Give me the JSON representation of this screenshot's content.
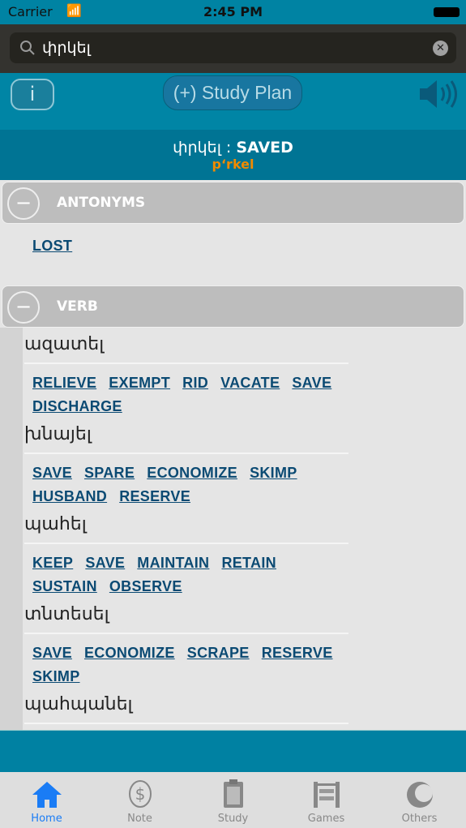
{
  "status": {
    "carrier": "Carrier",
    "time": "2:45 PM"
  },
  "search": {
    "value": "փրկել"
  },
  "toolbar": {
    "info_label": "i",
    "study_plan_label": "(+) Study Plan"
  },
  "title": {
    "word": "փրկել",
    "separator": " : ",
    "translation": "SAVED",
    "transliteration": "p‘rkel"
  },
  "sections": [
    {
      "label": "ANTONYMS",
      "links": [
        "LOST"
      ]
    },
    {
      "label": "VERB",
      "entries": [
        {
          "word": "ազատել",
          "links": [
            "RELIEVE",
            "EXEMPT",
            "RID",
            "VACATE",
            "SAVE",
            "DISCHARGE"
          ]
        },
        {
          "word": "խնայել",
          "links": [
            "SAVE",
            "SPARE",
            "ECONOMIZE",
            "SKIMP",
            "HUSBAND",
            "RESERVE"
          ]
        },
        {
          "word": "պահել",
          "links": [
            "KEEP",
            "SAVE",
            "MAINTAIN",
            "RETAIN",
            "SUSTAIN",
            "OBSERVE"
          ]
        },
        {
          "word": "տնտեսել",
          "links": [
            "SAVE",
            "ECONOMIZE",
            "SCRAPE",
            "RESERVE",
            "SKIMP"
          ]
        },
        {
          "word": "պահպանել",
          "links": []
        }
      ]
    }
  ],
  "tabs": [
    {
      "label": "Home",
      "icon": "home-icon",
      "active": true
    },
    {
      "label": "Note",
      "icon": "dollar-icon"
    },
    {
      "label": "Study",
      "icon": "clipboard-icon"
    },
    {
      "label": "Games",
      "icon": "abacus-icon"
    },
    {
      "label": "Others",
      "icon": "others-icon"
    }
  ],
  "colors": {
    "accent": "#0083a3",
    "active_tab": "#1a7cf5",
    "transliteration": "#f08a00",
    "link": "#0b4a73"
  }
}
